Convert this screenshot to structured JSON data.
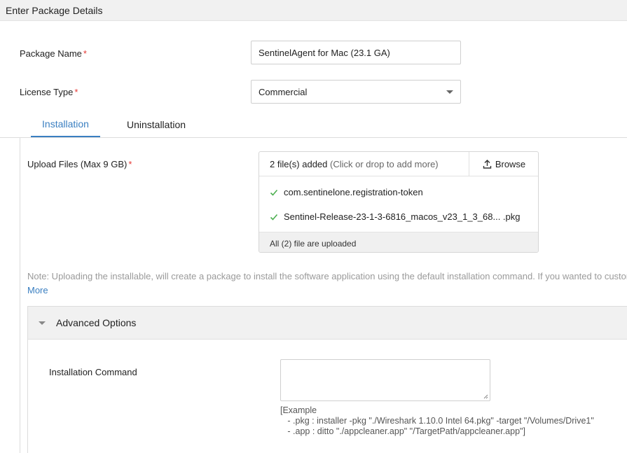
{
  "header": {
    "title": "Enter Package Details"
  },
  "form": {
    "package_name": {
      "label": "Package Name",
      "required_mark": "*",
      "value": "SentinelAgent for Mac (23.1 GA)"
    },
    "license_type": {
      "label": "License Type",
      "required_mark": "*",
      "selected": "Commercial"
    }
  },
  "tabs": [
    {
      "label": "Installation",
      "active": true
    },
    {
      "label": "Uninstallation",
      "active": false
    }
  ],
  "upload": {
    "label": "Upload Files (Max 9 GB)",
    "required_mark": "*",
    "added_text": "2 file(s) added",
    "hint_text": "(Click or drop to add more)",
    "browse_label": "Browse",
    "files": [
      {
        "name": "com.sentinelone.registration-token"
      },
      {
        "name": "Sentinel-Release-23-1-3-6816_macos_v23_1_3_68... .pkg"
      }
    ],
    "status": "All (2) file are uploaded",
    "check_color": "#4caf50"
  },
  "note": {
    "text": "Note: Uploading the installable, will create a package to install the software application using the default installation command. If you wanted to customiz",
    "more_label": "More"
  },
  "advanced": {
    "title": "Advanced Options",
    "installation_command": {
      "label": "Installation Command",
      "value": ""
    },
    "example_text": "[Example\n   - .pkg : installer -pkg \"./Wireshark 1.10.0 Intel 64.pkg\" -target \"/Volumes/Drive1\"\n   - .app : ditto \"./appcleaner.app\" \"/TargetPath/appcleaner.app\"]"
  },
  "colors": {
    "accent": "#3a7fc1",
    "required": "#e53935"
  }
}
